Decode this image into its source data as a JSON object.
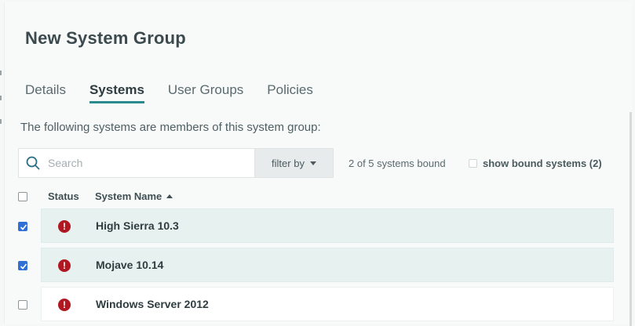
{
  "dialog": {
    "title": "New System Group"
  },
  "tabs": [
    {
      "label": "Details",
      "active": false
    },
    {
      "label": "Systems",
      "active": true
    },
    {
      "label": "User Groups",
      "active": false
    },
    {
      "label": "Policies",
      "active": false
    }
  ],
  "description": "The following systems are members of this system group:",
  "search": {
    "placeholder": "Search",
    "value": "",
    "icon": "search-icon"
  },
  "filter": {
    "label": "filter by"
  },
  "bound_summary": "2 of 5 systems bound",
  "show_bound": {
    "label": "show bound systems (2)",
    "checked": false
  },
  "table": {
    "columns": {
      "status": "Status",
      "name": "System Name"
    },
    "sort": "ascending",
    "rows": [
      {
        "name": "High Sierra 10.3",
        "checked": true,
        "status_icon": "!",
        "status": "error"
      },
      {
        "name": "Mojave 10.14",
        "checked": true,
        "status_icon": "!",
        "status": "error"
      },
      {
        "name": "Windows Server 2012",
        "checked": false,
        "status_icon": "!",
        "status": "error"
      }
    ]
  },
  "colors": {
    "accent": "#2a8a8e",
    "selected_row": "#e7f1ef",
    "error": "#b01721",
    "checkbox": "#2f6fd6"
  }
}
